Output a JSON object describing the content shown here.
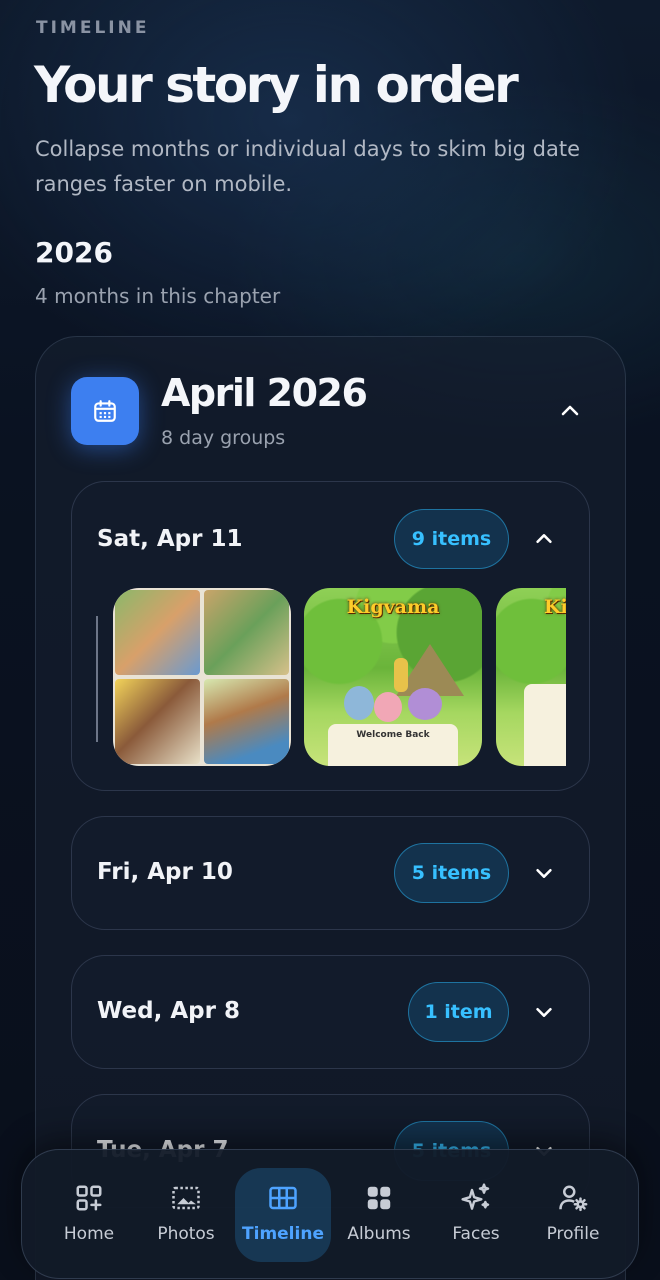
{
  "header": {
    "eyebrow": "TIMELINE",
    "title": "Your story in order",
    "subtitle": "Collapse months or individual days to skim big date ranges faster on mobile."
  },
  "year": {
    "label": "2026",
    "summary": "4 months in this chapter"
  },
  "month": {
    "title": "April 2026",
    "subtitle": "8 day groups",
    "icon": "calendar-icon",
    "expanded": true
  },
  "days": [
    {
      "label": "Sat, Apr 11",
      "count": "9 items",
      "expanded": true
    },
    {
      "label": "Fri, Apr 10",
      "count": "5 items",
      "expanded": false
    },
    {
      "label": "Wed, Apr 8",
      "count": "1 item",
      "expanded": false
    },
    {
      "label": "Tue, Apr 7",
      "count": "5 items",
      "expanded": false
    }
  ],
  "thumbnails": [
    {
      "kind": "storybook-collage",
      "caption": ""
    },
    {
      "kind": "game-screen",
      "caption": "Kigvama",
      "panel_text": "Welcome Back"
    },
    {
      "kind": "game-screen",
      "caption": "Ki",
      "panel_text": ""
    }
  ],
  "nav": {
    "items": [
      {
        "label": "Home",
        "icon": "home-grid-plus-icon",
        "active": false
      },
      {
        "label": "Photos",
        "icon": "photos-icon",
        "active": false
      },
      {
        "label": "Timeline",
        "icon": "timeline-grid-icon",
        "active": true
      },
      {
        "label": "Albums",
        "icon": "albums-icon",
        "active": false
      },
      {
        "label": "Faces",
        "icon": "sparkles-icon",
        "active": false
      },
      {
        "label": "Profile",
        "icon": "profile-gear-icon",
        "active": false
      }
    ]
  },
  "colors": {
    "accent_blue": "#3d7ff0",
    "pill_text": "#37c0ff",
    "active_nav": "#4ea3ff"
  }
}
